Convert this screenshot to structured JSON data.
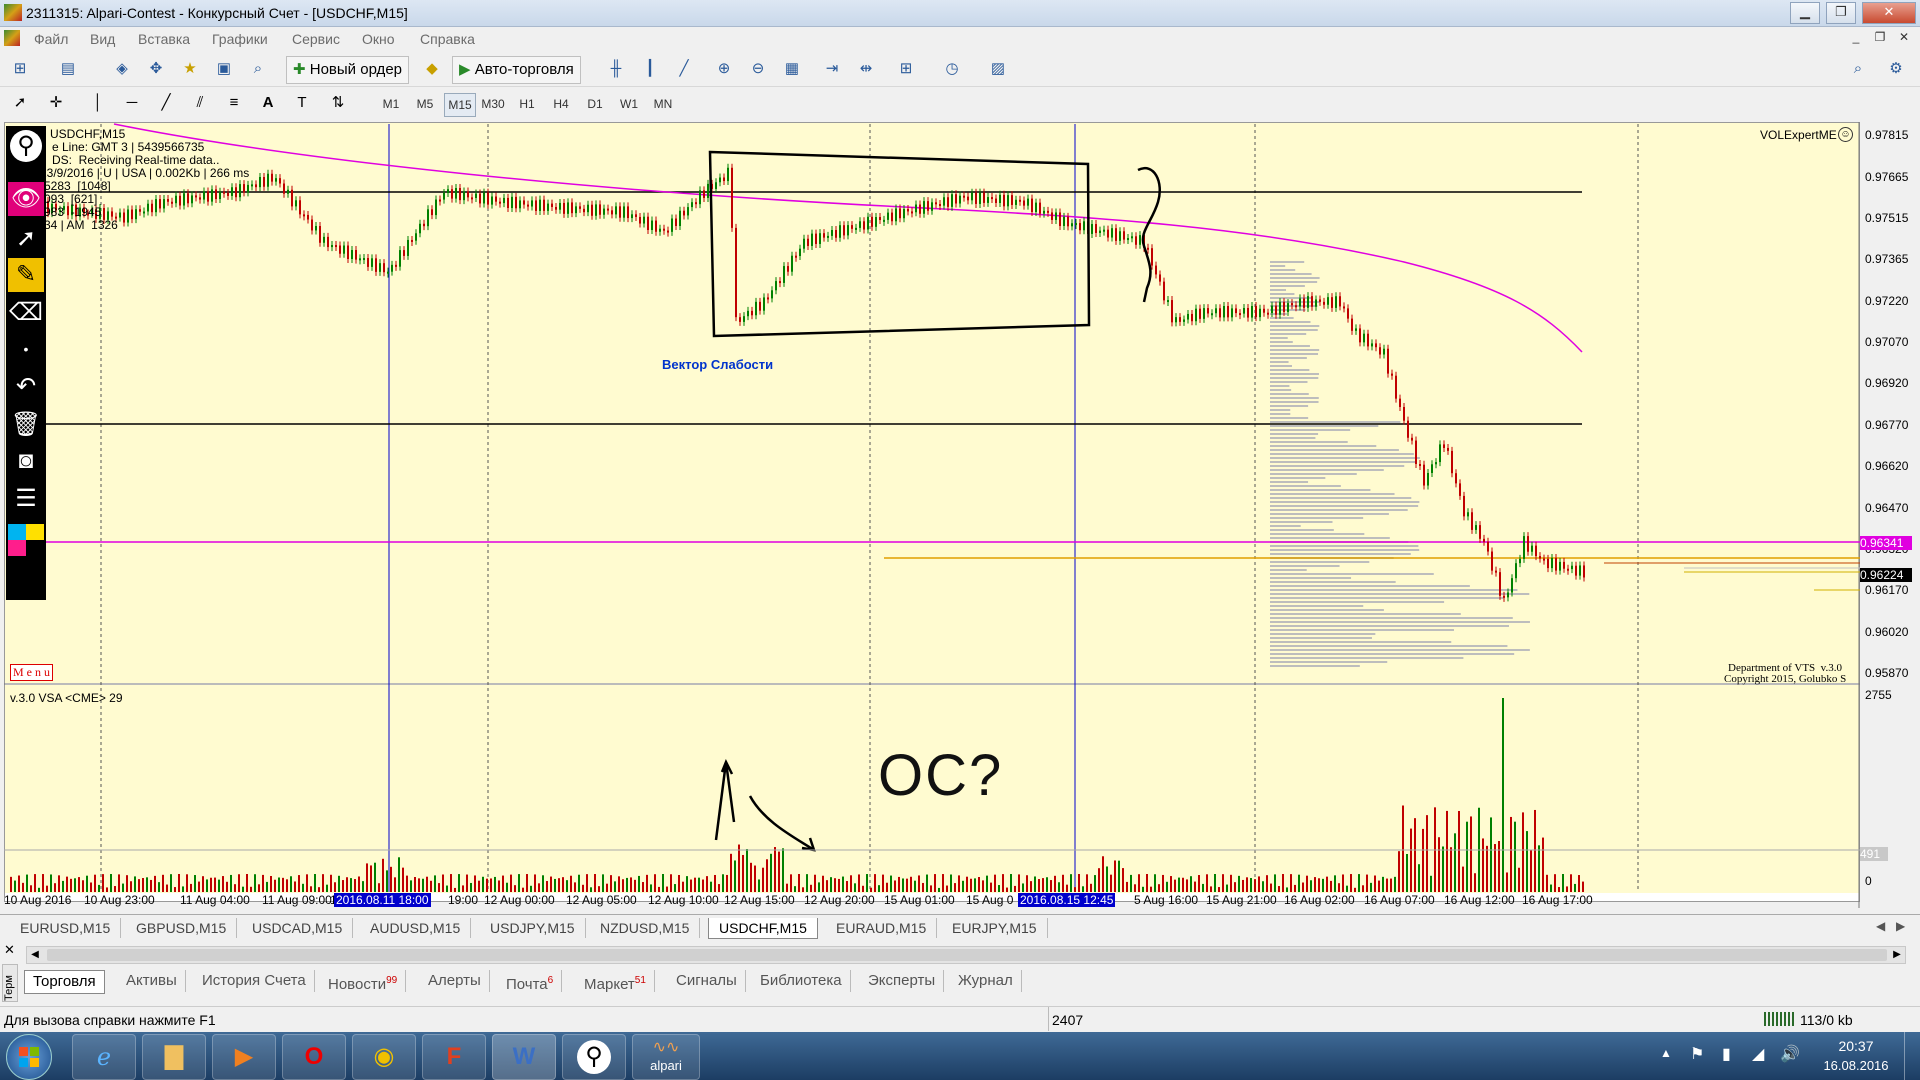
{
  "window": {
    "title": "2311315: Alpari-Contest - Конкурсный Счет - [USDCHF,M15]",
    "minimize": "▁",
    "maximize": "❐",
    "close": "✕"
  },
  "menu": [
    "Файл",
    "Вид",
    "Вставка",
    "Графики",
    "Сервис",
    "Окно",
    "Справка"
  ],
  "toolbar": {
    "new_order": "Новый ордер",
    "auto_trading": "Авто-торговля"
  },
  "timeframes": [
    "M1",
    "M5",
    "M15",
    "M30",
    "H1",
    "H4",
    "D1",
    "W1",
    "MN"
  ],
  "active_timeframe": "M15",
  "chart": {
    "symbol_line": "USDCHF,M15",
    "info_lines": [
      "e Line: GMT 3 | 5439566735",
      "DS:  Receiving Real-time data..",
      "13/9/2016 | U | USA | 0.002Kb | 266 ms",
      "5283  [1048]",
      "093  [621]",
      "983  -1945",
      "34 | AM  1326"
    ],
    "indicator_name": "VOLExpertME",
    "annotation": "Вектор Слабости",
    "handwriting_label": "ОС?",
    "menu_label": "M e n u",
    "copyright_line1": "Department of VTS  v.3.0",
    "copyright_line2": "Copyright 2015, Golubko S",
    "current_price": "0.96224",
    "level_price": "0.96341",
    "price_labels": [
      "0.97815",
      "0.97665",
      "0.97515",
      "0.97365",
      "0.97220",
      "0.97070",
      "0.96920",
      "0.96770",
      "0.96620",
      "0.96470",
      "0.96320",
      "0.96170",
      "0.96020",
      "0.95870"
    ],
    "sub_indicator": "v.3.0 VSA <CME> 29",
    "volume_labels": [
      "2755",
      "491",
      "0"
    ],
    "time_labels": [
      "10 Aug 2016",
      "10 Aug 23:00",
      "11 Aug 04:00",
      "11 Aug 09:00",
      "1",
      "2016.08.11 18:00",
      "19:00",
      "12 Aug 00:00",
      "12 Aug 05:00",
      "12 Aug 10:00",
      "12 Aug 15:00",
      "12 Aug 20:00",
      "15 Aug 01:00",
      "15 Aug 0",
      "2016.08.15 12:45",
      "5 Aug 16:00",
      "15 Aug 21:00",
      "16 Aug 02:00",
      "16 Aug 07:00",
      "16 Aug 12:00",
      "16 Aug 17:00"
    ]
  },
  "symbol_tabs": [
    "EURUSD,M15",
    "GBPUSD,M15",
    "USDCAD,M15",
    "AUDUSD,M15",
    "USDJPY,M15",
    "NZDUSD,M15",
    "USDCHF,M15",
    "EURAUD,M15",
    "EURJPY,M15"
  ],
  "active_symbol_tab": "USDCHF,M15",
  "terminal_tabs": [
    {
      "label": "Торговля",
      "badge": ""
    },
    {
      "label": "Активы",
      "badge": ""
    },
    {
      "label": "История Счета",
      "badge": ""
    },
    {
      "label": "Новости",
      "badge": "99"
    },
    {
      "label": "Алерты",
      "badge": ""
    },
    {
      "label": "Почта",
      "badge": "6"
    },
    {
      "label": "Маркет",
      "badge": "51"
    },
    {
      "label": "Сигналы",
      "badge": ""
    },
    {
      "label": "Библиотека",
      "badge": ""
    },
    {
      "label": "Эксперты",
      "badge": ""
    },
    {
      "label": "Журнал",
      "badge": ""
    }
  ],
  "terminal_side_label": "Терм",
  "status": {
    "help": "Для вызова справки нажмите F1",
    "value": "2407",
    "traffic": "113/0 kb"
  },
  "taskbar": {
    "time": "20:37",
    "date": "16.08.2016",
    "alpari_label": "alpari"
  },
  "colors": {
    "chart_bg": "#fffbd0",
    "candle_up": "#008000",
    "candle_down": "#c00000",
    "ma_line": "#e000e0",
    "level_line": "#e000e0",
    "orange_line": "#e0a000",
    "period_line": "#0000cc"
  }
}
